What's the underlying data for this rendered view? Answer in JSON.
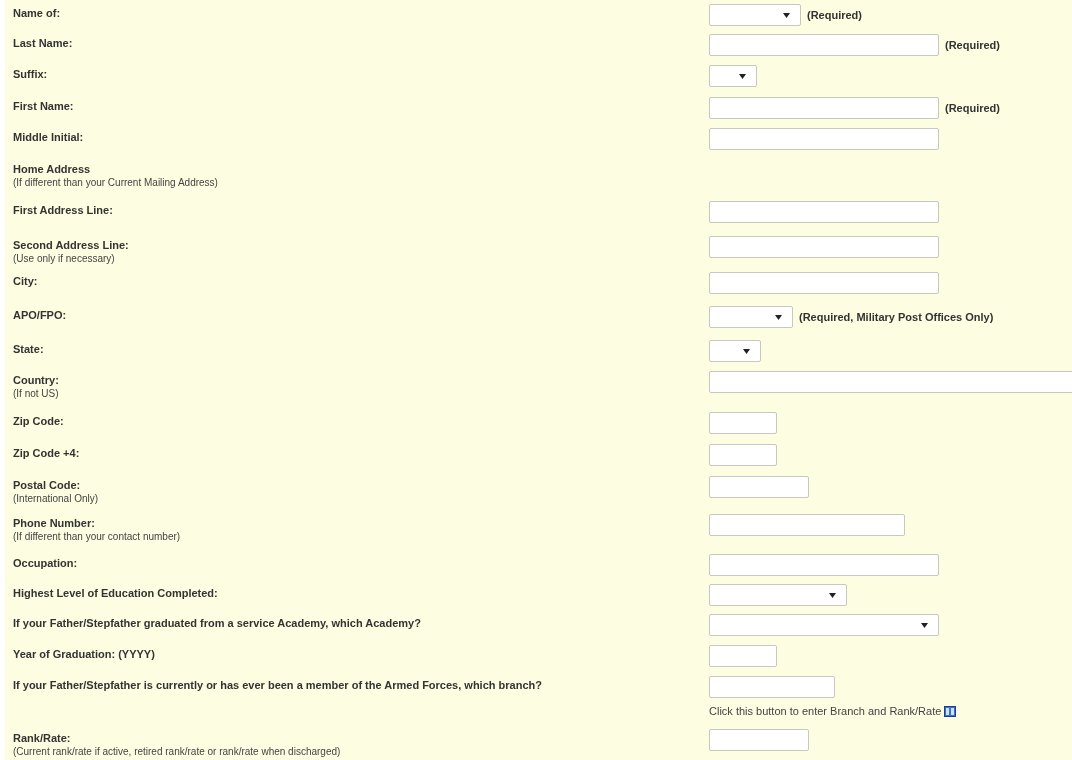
{
  "rows": [
    {
      "label": "Name of:",
      "kind": "select",
      "note": "(Required)"
    },
    {
      "label": "Last Name:",
      "kind": "text",
      "note": "(Required)"
    },
    {
      "label": "Suffix:",
      "kind": "select"
    },
    {
      "label": "First Name:",
      "kind": "text",
      "note": "(Required)"
    },
    {
      "label": "Middle Initial:",
      "kind": "text"
    },
    {
      "label": "Home Address",
      "hint": "(If different than your Current Mailing Address)",
      "kind": "none"
    },
    {
      "label": "First Address Line:",
      "kind": "text"
    },
    {
      "label": "Second Address Line:",
      "hint": "(Use only if necessary)",
      "kind": "text"
    },
    {
      "label": "City:",
      "kind": "text"
    },
    {
      "label": "APO/FPO:",
      "kind": "select",
      "note": "(Required, Military Post Offices Only)"
    },
    {
      "label": "State:",
      "kind": "select"
    },
    {
      "label": "Country:",
      "hint": "(If not US)",
      "kind": "text"
    },
    {
      "label": "Zip Code:",
      "kind": "text"
    },
    {
      "label": "Zip Code +4:",
      "kind": "text"
    },
    {
      "label": "Postal Code:",
      "hint": "(International Only)",
      "kind": "text"
    },
    {
      "label": "Phone Number:",
      "hint": "(If different than your contact number)",
      "kind": "text"
    },
    {
      "label": "Occupation:",
      "kind": "text"
    },
    {
      "label": "Highest Level of Education Completed:",
      "kind": "select"
    },
    {
      "label": "If your Father/Stepfather graduated from a service Academy, which Academy?",
      "kind": "select"
    },
    {
      "label": "Year of Graduation: (YYYY)",
      "kind": "text"
    },
    {
      "label": "If your Father/Stepfather is currently or has ever been a member of the Armed Forces, which branch?",
      "kind": "text",
      "helper": "Click this button to enter Branch and Rank/Rate"
    },
    {
      "label": "Rank/Rate:",
      "hint": "(Current rank/rate if active, retired rank/rate or rank/rate when discharged)",
      "kind": "text"
    }
  ]
}
